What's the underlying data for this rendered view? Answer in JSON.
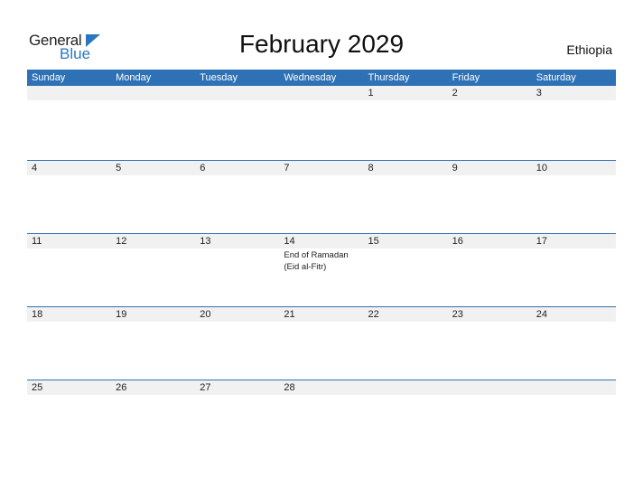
{
  "logo": {
    "word1": "General",
    "word2": "Blue"
  },
  "title": "February 2029",
  "country": "Ethiopia",
  "colors": {
    "accent": "#2e71b5",
    "band": "#f1f1f1"
  },
  "weekdays": [
    "Sunday",
    "Monday",
    "Tuesday",
    "Wednesday",
    "Thursday",
    "Friday",
    "Saturday"
  ],
  "weeks": [
    [
      {
        "day": ""
      },
      {
        "day": ""
      },
      {
        "day": ""
      },
      {
        "day": ""
      },
      {
        "day": "1"
      },
      {
        "day": "2"
      },
      {
        "day": "3"
      }
    ],
    [
      {
        "day": "4"
      },
      {
        "day": "5"
      },
      {
        "day": "6"
      },
      {
        "day": "7"
      },
      {
        "day": "8"
      },
      {
        "day": "9"
      },
      {
        "day": "10"
      }
    ],
    [
      {
        "day": "11"
      },
      {
        "day": "12"
      },
      {
        "day": "13"
      },
      {
        "day": "14",
        "event": "End of Ramadan (Eid al-Fitr)"
      },
      {
        "day": "15"
      },
      {
        "day": "16"
      },
      {
        "day": "17"
      }
    ],
    [
      {
        "day": "18"
      },
      {
        "day": "19"
      },
      {
        "day": "20"
      },
      {
        "day": "21"
      },
      {
        "day": "22"
      },
      {
        "day": "23"
      },
      {
        "day": "24"
      }
    ],
    [
      {
        "day": "25"
      },
      {
        "day": "26"
      },
      {
        "day": "27"
      },
      {
        "day": "28"
      },
      {
        "day": ""
      },
      {
        "day": ""
      },
      {
        "day": ""
      }
    ]
  ]
}
